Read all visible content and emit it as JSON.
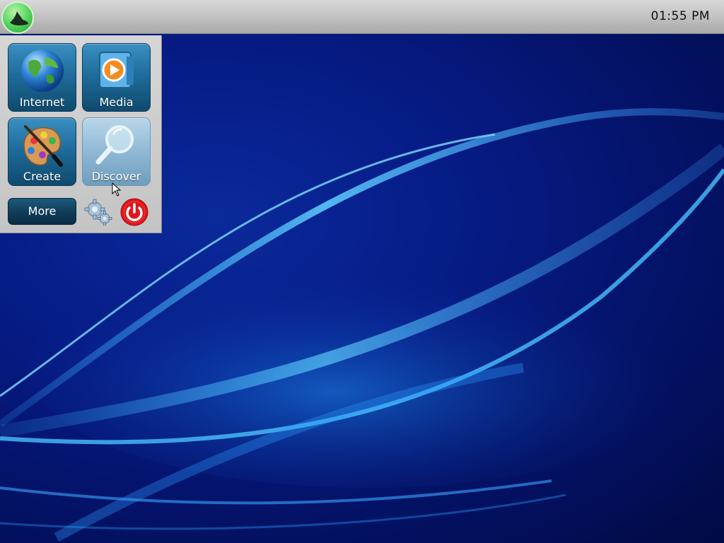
{
  "panel": {
    "clock": "01:55 PM",
    "start_icon": "wizard-hat-icon"
  },
  "launcher": {
    "tiles": [
      {
        "label": "Internet",
        "icon": "globe-icon"
      },
      {
        "label": "Media",
        "icon": "media-player-icon"
      },
      {
        "label": "Create",
        "icon": "paint-palette-icon"
      },
      {
        "label": "Discover",
        "icon": "magnifying-glass-icon",
        "state": "hovered"
      }
    ],
    "more_label": "More",
    "settings_icon": "gears-icon",
    "power_icon": "power-icon"
  },
  "colors": {
    "panel": "#c8c8c8",
    "tile": "#1f6d9c",
    "tile_hover": "#8fb9d5",
    "desktop": "#061b86",
    "power": "#e0151b",
    "start": "#4fd35a"
  }
}
